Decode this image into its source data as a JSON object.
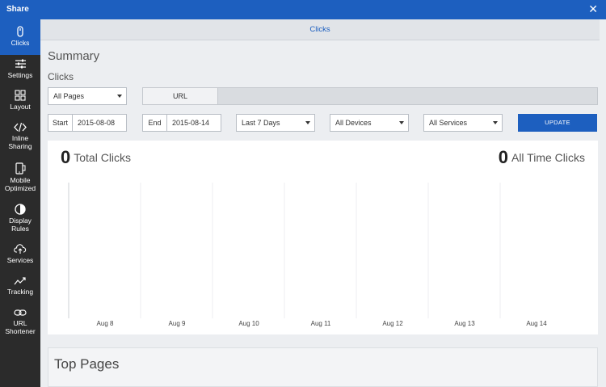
{
  "window": {
    "title": "Share"
  },
  "sidebar": {
    "items": [
      {
        "label": "Clicks",
        "icon": "mouse-icon"
      },
      {
        "label": "Settings",
        "icon": "sliders-icon"
      },
      {
        "label": "Layout",
        "icon": "grid-icon"
      },
      {
        "label": "Inline Sharing",
        "icon": "code-icon"
      },
      {
        "label": "Mobile Optimized",
        "icon": "phone-icon"
      },
      {
        "label": "Display Rules",
        "icon": "half-circle-icon"
      },
      {
        "label": "Services",
        "icon": "upload-cloud-icon"
      },
      {
        "label": "Tracking",
        "icon": "trend-line-icon"
      },
      {
        "label": "URL Shortener",
        "icon": "link-icon"
      }
    ]
  },
  "tab": {
    "label": "Clicks"
  },
  "page": {
    "title": "Summary",
    "subtitle": "Clicks"
  },
  "filters": {
    "pages_select": "All Pages",
    "url_label": "URL",
    "url_value": "",
    "start_label": "Start",
    "start_value": "2015-08-08",
    "end_label": "End",
    "end_value": "2015-08-14",
    "range_select": "Last 7 Days",
    "devices_select": "All Devices",
    "services_select": "All Services",
    "update_label": "UPDATE"
  },
  "stats": {
    "total_value": "0",
    "total_label": "Total Clicks",
    "alltime_value": "0",
    "alltime_label": "All Time Clicks"
  },
  "chart_data": {
    "type": "line",
    "categories": [
      "Aug 8",
      "Aug 9",
      "Aug 10",
      "Aug 11",
      "Aug 12",
      "Aug 13",
      "Aug 14"
    ],
    "series": [
      {
        "values": [
          0,
          0,
          0,
          0,
          0,
          0,
          0
        ]
      }
    ],
    "title": "",
    "xlabel": "",
    "ylabel": "",
    "grid": true
  },
  "top_pages": {
    "title": "Top Pages"
  },
  "colors": {
    "accent": "#1d5fbf",
    "sidebar": "#2b2b2b"
  }
}
